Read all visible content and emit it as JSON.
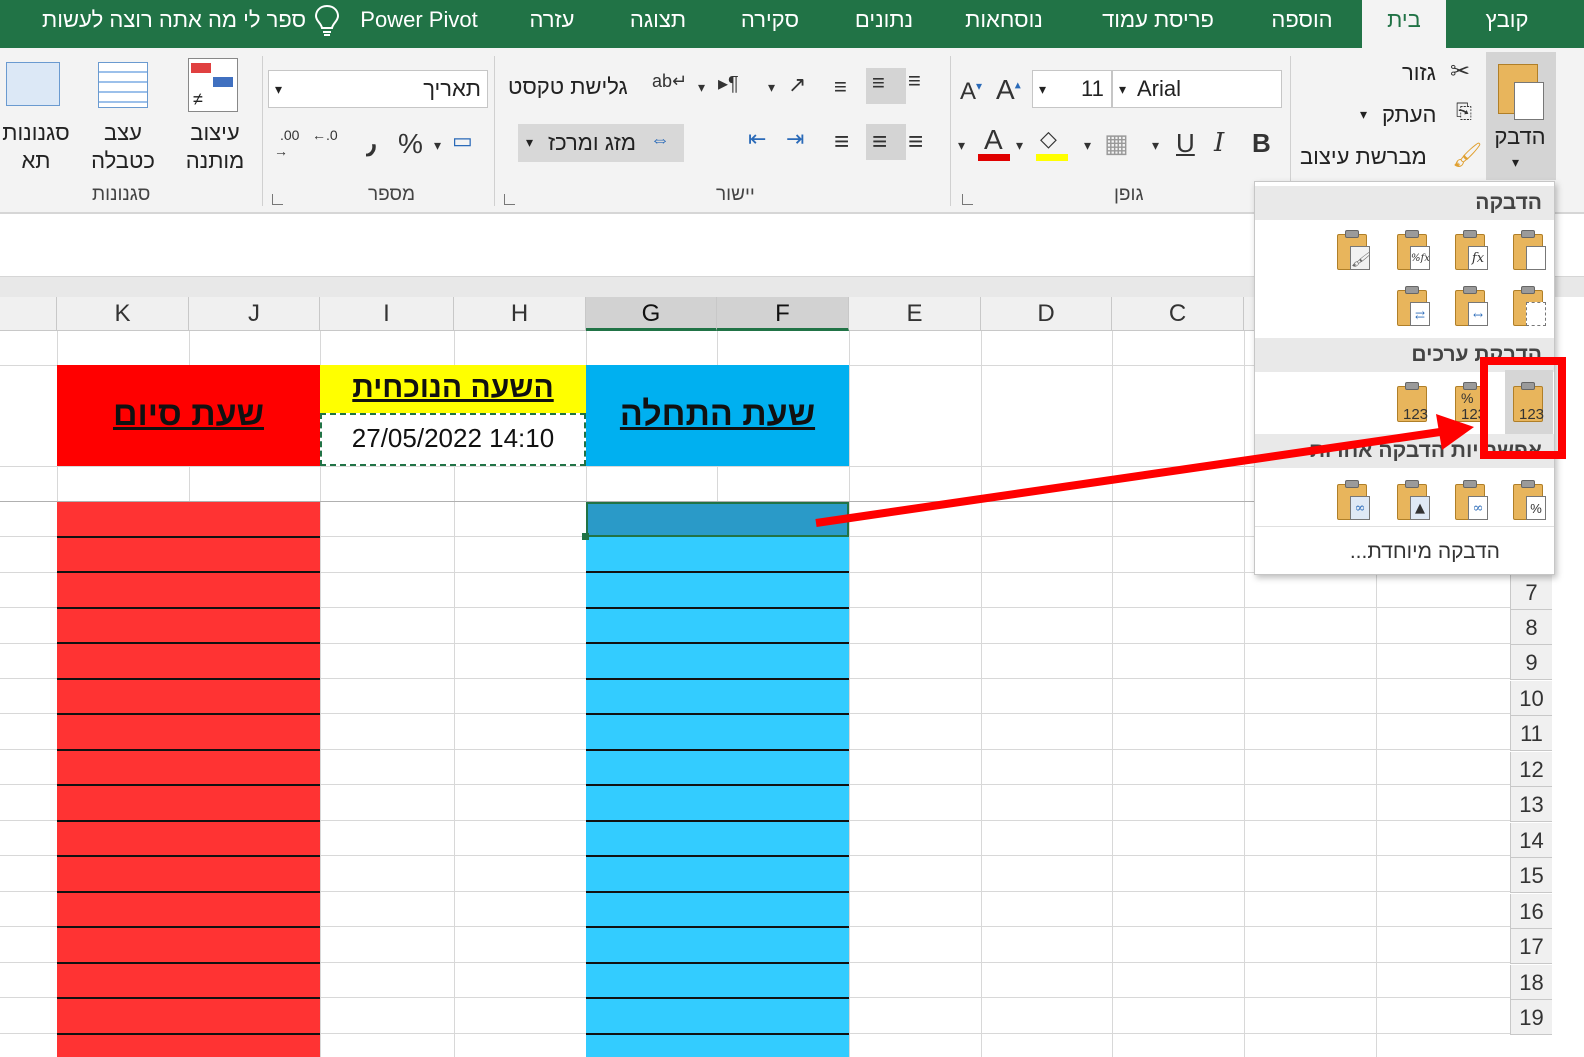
{
  "tabs": {
    "file": "קובץ",
    "home": "בית",
    "insert": "הוספה",
    "page_layout": "פריסת עמוד",
    "formulas": "נוסחאות",
    "data": "נתונים",
    "review": "סקירה",
    "view": "תצוגה",
    "help": "עזרה",
    "power_pivot": "Power Pivot",
    "tell_me": "ספר לי מה אתה רוצה לעשות"
  },
  "ribbon": {
    "clipboard": {
      "paste": "הדבק",
      "cut": "גזור",
      "copy": "העתק",
      "format_painter": "מברשת עיצוב"
    },
    "font": {
      "group_label": "גופן",
      "font_name": "Arial",
      "font_size": "11",
      "bold": "B",
      "italic": "I",
      "underline": "U",
      "font_color_letter": "A",
      "grow": "A",
      "shrink": "A"
    },
    "alignment": {
      "group_label": "יישור",
      "wrap_text": "גלישת טקסט",
      "merge_center": "מזג ומרכז"
    },
    "number": {
      "group_label": "מספר",
      "format": "תאריך",
      "percent": "%",
      "comma": "٫",
      "inc_decimal": ".00",
      "dec_decimal": ".0"
    },
    "styles": {
      "group_label": "סגנונות",
      "conditional_line1": "עיצוב",
      "conditional_line2": "מותנה",
      "format_table_line1": "עצב",
      "format_table_line2": "כטבלה",
      "cell_styles_line1": "סגנונות",
      "cell_styles_line2": "תא"
    }
  },
  "columns": [
    "K",
    "J",
    "I",
    "H",
    "G",
    "F",
    "E",
    "D",
    "C"
  ],
  "cells": {
    "end_time": "שעת סיום",
    "current_time": "השעה הנוכחית",
    "current_value": "27/05/2022 14:10",
    "start_time": "שעת התחלה"
  },
  "rows": [
    "7",
    "8",
    "9",
    "10",
    "11",
    "12",
    "13",
    "14",
    "15",
    "16",
    "17",
    "18",
    "19"
  ],
  "paste_menu": {
    "section_paste": "הדבקה",
    "section_values": "הדבקת ערכים",
    "section_other": "אפשרויות הדבקה אחרות",
    "paste_special": "הדבקה מיוחדת...",
    "fx": "fx",
    "percent_fx": "%fx",
    "values_123": "123",
    "percent": "%"
  },
  "colors": {
    "tab_green": "#217346",
    "end_fill": "#ff3333",
    "current_fill": "#ffff00",
    "start_fill": "#33ccff",
    "start_header_fill": "#00b0f0",
    "highlight": "#ff0000"
  }
}
